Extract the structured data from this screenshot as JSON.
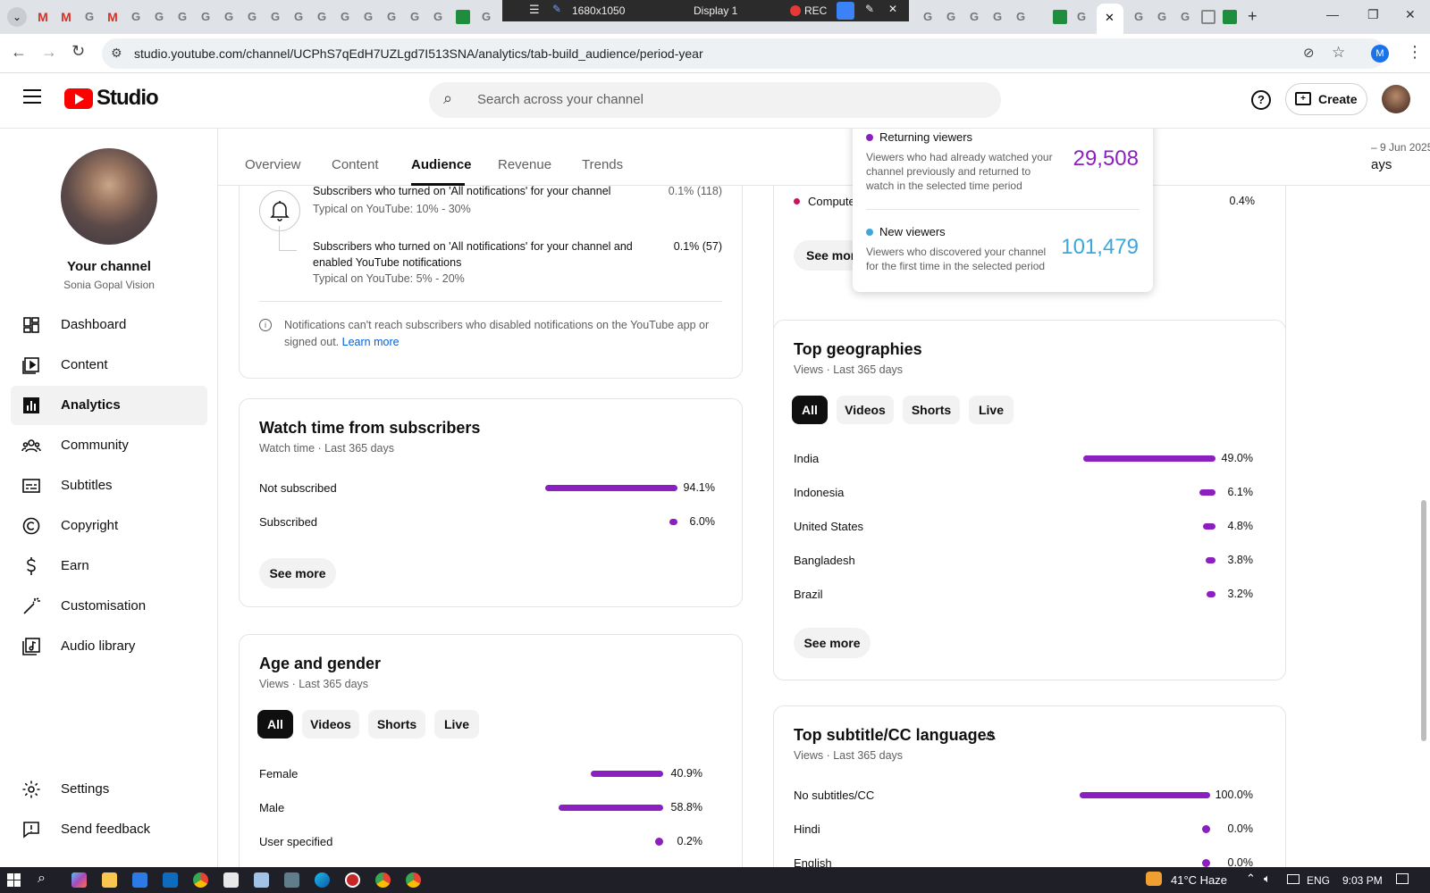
{
  "recorder": {
    "resolution": "1680x1050",
    "display": "Display 1",
    "rec_label": "REC"
  },
  "browser": {
    "url": "studio.youtube.com/channel/UCPhS7qEdH7UZLgd7I513SNA/analytics/tab-build_audience/period-year",
    "profile_initial": "M"
  },
  "header": {
    "logo_text": "Studio",
    "search_placeholder": "Search across your channel",
    "create_label": "Create"
  },
  "channel": {
    "title": "Your channel",
    "name": "Sonia Gopal Vision"
  },
  "sidebar": {
    "items": [
      {
        "label": "Dashboard",
        "icon": "dashboard-icon"
      },
      {
        "label": "Content",
        "icon": "content-icon"
      },
      {
        "label": "Analytics",
        "icon": "analytics-icon",
        "active": true
      },
      {
        "label": "Community",
        "icon": "community-icon"
      },
      {
        "label": "Subtitles",
        "icon": "subtitles-icon"
      },
      {
        "label": "Copyright",
        "icon": "copyright-icon"
      },
      {
        "label": "Earn",
        "icon": "earn-icon"
      },
      {
        "label": "Customisation",
        "icon": "customisation-icon"
      },
      {
        "label": "Audio library",
        "icon": "audio-library-icon"
      }
    ],
    "settings": "Settings",
    "feedback": "Send feedback"
  },
  "tabs": [
    "Overview",
    "Content",
    "Audience",
    "Revenue",
    "Trends"
  ],
  "date_range": {
    "range_partial": "– 9 Jun 2025",
    "label_partial": "ays"
  },
  "notifications_card": {
    "row1_label": "Subscribers who turned on 'All notifications' for your channel",
    "row1_typical": "Typical on YouTube: 10% - 30%",
    "row1_value": "0.1% (118)",
    "row2_label": "Subscribers who turned on 'All notifications' for your channel and enabled YouTube notifications",
    "row2_typical": "Typical on YouTube: 5% - 20%",
    "row2_value": "0.1% (57)",
    "info_text": "Notifications can't reach subscribers who disabled notifications on the YouTube app or signed out.",
    "learn_more": "Learn more"
  },
  "watch_time_card": {
    "title": "Watch time from subscribers",
    "subtitle": "Watch time · Last 365 days",
    "rows": [
      {
        "label": "Not subscribed",
        "pct": "94.1%",
        "value": 94.1
      },
      {
        "label": "Subscribed",
        "pct": "6.0%",
        "value": 6.0
      }
    ],
    "see_more": "See more"
  },
  "age_gender_card": {
    "title": "Age and gender",
    "subtitle": "Views · Last 365 days",
    "chips": [
      "All",
      "Videos",
      "Shorts",
      "Live"
    ],
    "rows": [
      {
        "label": "Female",
        "pct": "40.9%",
        "value": 40.9
      },
      {
        "label": "Male",
        "pct": "58.8%",
        "value": 58.8
      },
      {
        "label": "User specified",
        "pct": "0.2%",
        "value": 0.2
      }
    ]
  },
  "device_card": {
    "row_label_partial": "Compute",
    "row_pct": "0.4%",
    "see_more_partial": "See mor"
  },
  "popover": {
    "returning_title": "Returning viewers",
    "returning_desc": "Viewers who had already watched your channel previously and returned to watch in the selected time period",
    "returning_value": "29,508",
    "new_title": "New viewers",
    "new_desc": "Viewers who discovered your channel for the first time in the selected period",
    "new_value": "101,479",
    "returning_color": "#8c1fbf",
    "new_color": "#3ea6dc"
  },
  "geographies_card": {
    "title": "Top geographies",
    "subtitle": "Views · Last 365 days",
    "chips": [
      "All",
      "Videos",
      "Shorts",
      "Live"
    ],
    "rows": [
      {
        "label": "India",
        "pct": "49.0%",
        "value": 49.0
      },
      {
        "label": "Indonesia",
        "pct": "6.1%",
        "value": 6.1
      },
      {
        "label": "United States",
        "pct": "4.8%",
        "value": 4.8
      },
      {
        "label": "Bangladesh",
        "pct": "3.8%",
        "value": 3.8
      },
      {
        "label": "Brazil",
        "pct": "3.2%",
        "value": 3.2
      }
    ],
    "see_more": "See more"
  },
  "subtitle_card": {
    "title": "Top subtitle/CC languages",
    "subtitle": "Views · Last 365 days",
    "rows": [
      {
        "label": "No subtitles/CC",
        "pct": "100.0%",
        "value": 100.0
      },
      {
        "label": "Hindi",
        "pct": "0.0%",
        "value": 0.0
      },
      {
        "label": "English",
        "pct": "0.0%",
        "value": 0.0
      }
    ]
  },
  "taskbar": {
    "weather": "41°C Haze",
    "lang": "ENG",
    "time": "9:03 PM"
  },
  "colors": {
    "accent": "#8c1fbf",
    "brand_red": "#ff0000"
  }
}
